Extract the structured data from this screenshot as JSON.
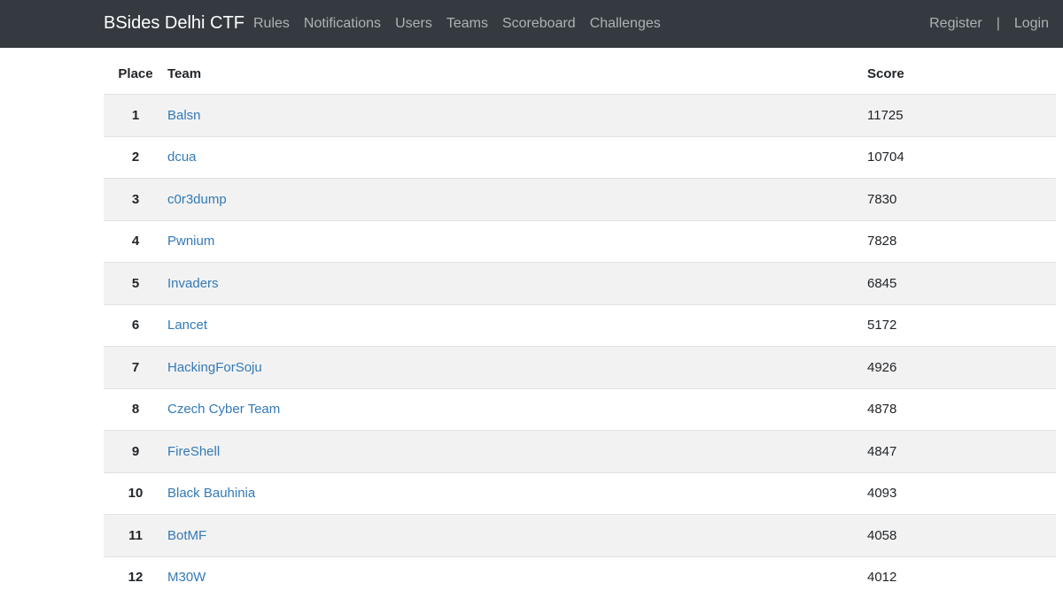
{
  "navbar": {
    "brand": "BSides Delhi CTF",
    "links": [
      "Rules",
      "Notifications",
      "Users",
      "Teams",
      "Scoreboard",
      "Challenges"
    ],
    "register": "Register",
    "separator": "|",
    "login": "Login"
  },
  "scoreboard": {
    "headers": {
      "place": "Place",
      "team": "Team",
      "score": "Score"
    },
    "rows": [
      {
        "place": "1",
        "team": "Balsn",
        "score": "11725"
      },
      {
        "place": "2",
        "team": "dcua",
        "score": "10704"
      },
      {
        "place": "3",
        "team": "c0r3dump",
        "score": "7830"
      },
      {
        "place": "4",
        "team": "Pwnium",
        "score": "7828"
      },
      {
        "place": "5",
        "team": "Invaders",
        "score": "6845"
      },
      {
        "place": "6",
        "team": "Lancet",
        "score": "5172"
      },
      {
        "place": "7",
        "team": "HackingForSoju",
        "score": "4926"
      },
      {
        "place": "8",
        "team": "Czech Cyber Team",
        "score": "4878"
      },
      {
        "place": "9",
        "team": "FireShell",
        "score": "4847"
      },
      {
        "place": "10",
        "team": "Black Bauhinia",
        "score": "4093"
      },
      {
        "place": "11",
        "team": "BotMF",
        "score": "4058"
      },
      {
        "place": "12",
        "team": "M30W",
        "score": "4012"
      }
    ]
  }
}
